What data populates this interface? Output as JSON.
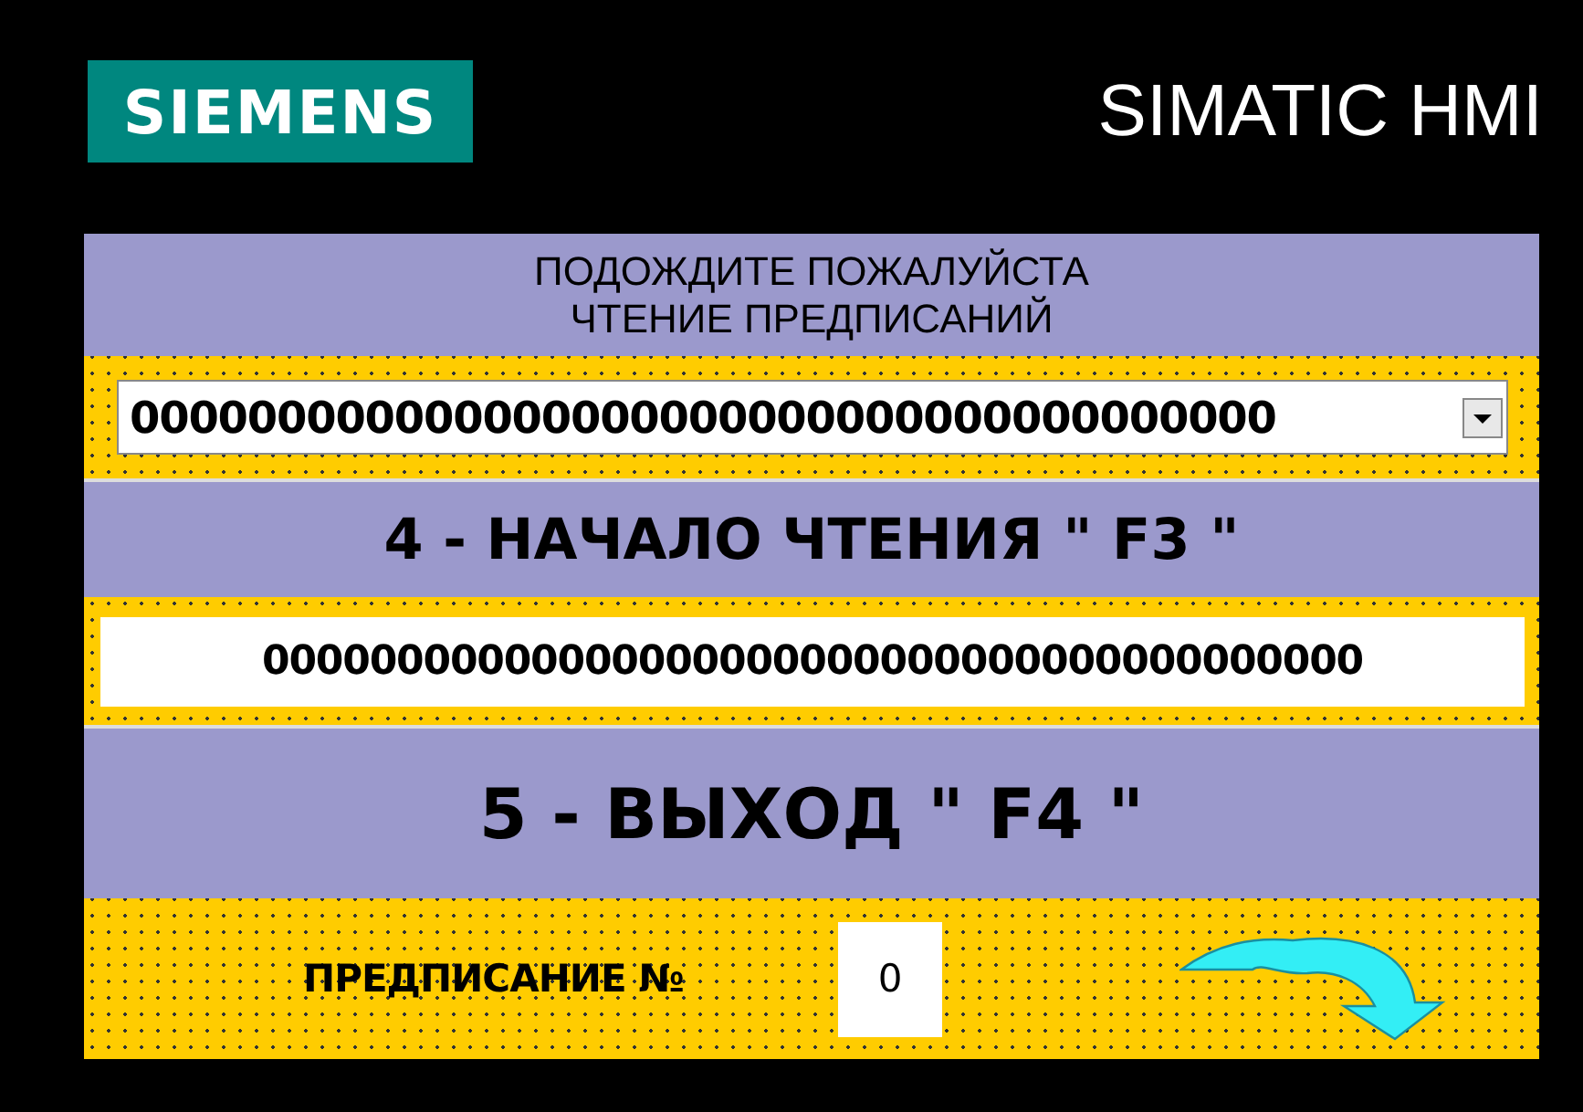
{
  "header": {
    "logo": "SIEMENS",
    "product": "SIMATIC HMI"
  },
  "panel": {
    "message": [
      "ПОДОЖДИТЕ ПОЖАЛУЙСТА",
      "ЧТЕНИЕ ПРЕДПИСАНИЙ"
    ],
    "dropdown": {
      "value": "000000000000000000000000000000000000000"
    },
    "start_button": "4 - НАЧАЛО ЧТЕНИЯ \" F3 \"",
    "output_field": {
      "value": "00000000000000000000000000000000000000000"
    },
    "exit_button": "5 - ВЫХОД \" F4 \"",
    "prescription": {
      "label": "ПРЕДПИСАНИЕ №",
      "value": "0"
    }
  }
}
